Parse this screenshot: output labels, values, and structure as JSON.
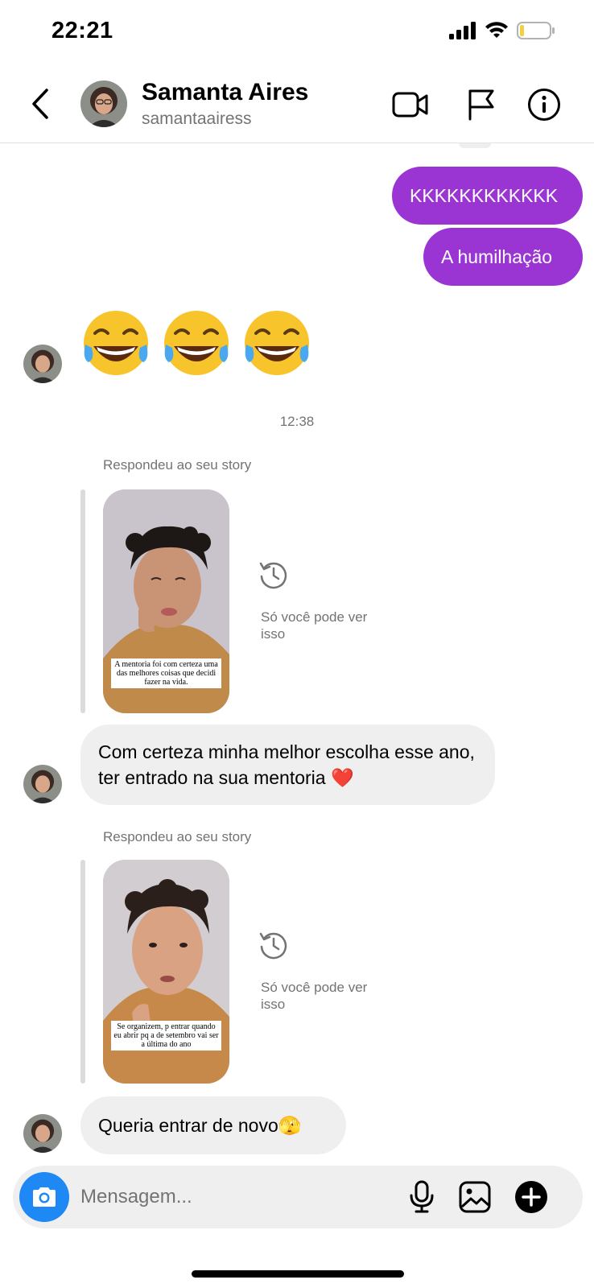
{
  "status_bar": {
    "time": "22:21"
  },
  "header": {
    "name": "Samanta Aires",
    "username": "samantaairess"
  },
  "messages": {
    "sent_1": "KKKKKKKKKKKK",
    "sent_2": "A humilhação",
    "emojis": [
      "😂",
      "😂",
      "😂"
    ],
    "timestamp": "12:38",
    "story_reply_1": {
      "label": "Respondeu ao seu story",
      "caption": "A mentoria foi com certeza uma das melhores coisas que decidi fazer na vida.",
      "only_you": "Só você pode ver isso"
    },
    "received_1": "Com certeza minha melhor escolha esse ano, ter entrado na sua mentoria ❤️",
    "story_reply_2": {
      "label": "Respondeu ao seu story",
      "caption": "Se organizem, p entrar quando eu abrir pq a de setembro vai ser a última do ano",
      "only_you": "Só você pode ver isso"
    },
    "received_2": "Queria entrar de novo🫣"
  },
  "composer": {
    "placeholder": "Mensagem..."
  },
  "colors": {
    "sent_bubble": "#9a35d4",
    "received_bubble": "#efefef",
    "camera_button": "#1e88f5"
  },
  "icons": [
    "signal-icon",
    "wifi-icon",
    "battery-icon",
    "back-arrow-icon",
    "video-call-icon",
    "flag-icon",
    "info-icon",
    "history-icon",
    "camera-icon",
    "microphone-icon",
    "gallery-icon",
    "plus-icon"
  ]
}
